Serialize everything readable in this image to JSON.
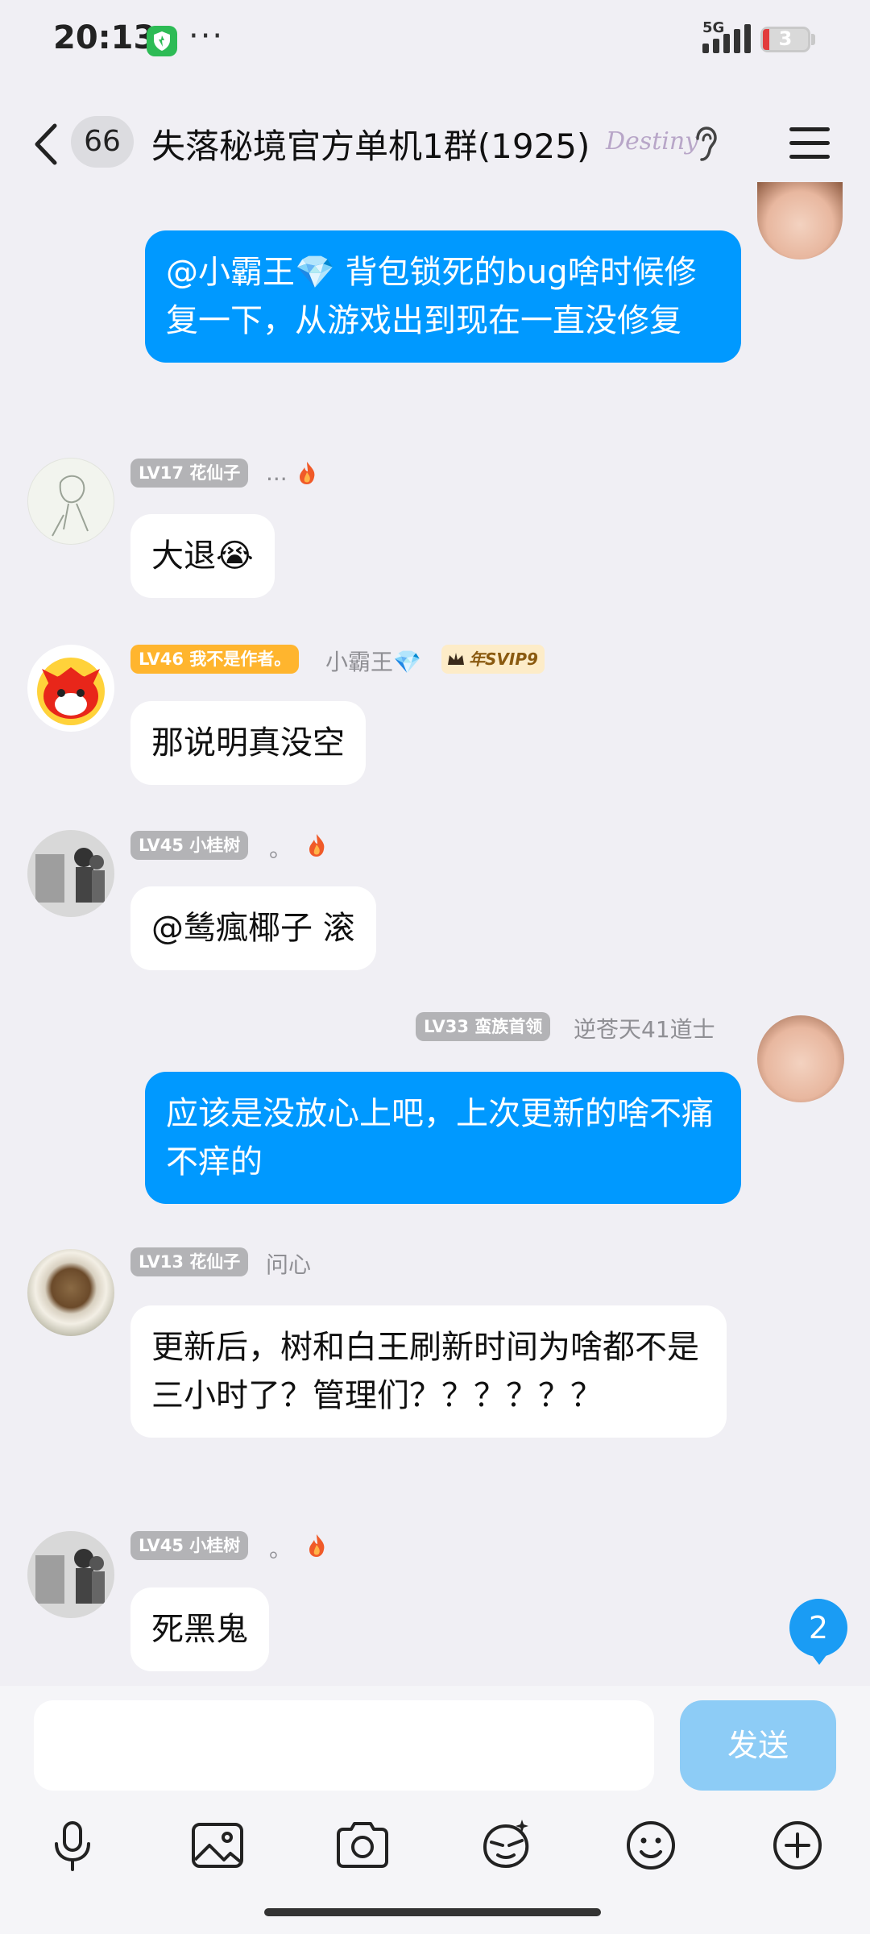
{
  "status_bar": {
    "time": "20:13",
    "more": "···",
    "network": "5G",
    "battery": "3"
  },
  "title_bar": {
    "unread_count": "66",
    "title": "失落秘境官方单机1群(1925)",
    "logo_text": "Destiny"
  },
  "messages": [
    {
      "side": "right",
      "text": "@小霸王💎 背包锁死的bug啥时候修复一下，从游戏出到现在一直没修复"
    },
    {
      "side": "left",
      "level": "LV17 花仙子",
      "name": "...",
      "text": "大退😭"
    },
    {
      "side": "left",
      "level": "LV46 我不是作者。",
      "name": "小霸王💎",
      "vip": "年SVIP9",
      "text": "那说明真没空"
    },
    {
      "side": "left",
      "level": "LV45 小桂树",
      "name": "。",
      "text": "@鸶瘋椰子 滚"
    },
    {
      "side": "right",
      "level": "LV33 蛮族首领",
      "name": "逆苍天41道士",
      "text": "应该是没放心上吧，上次更新的啥不痛不痒的"
    },
    {
      "side": "left",
      "level": "LV13 花仙子",
      "name": "问心",
      "text": "更新后，树和白王刷新时间为啥都不是三小时了？管理们？？？？？？"
    },
    {
      "side": "left",
      "level": "LV45 小桂树",
      "name": "。",
      "text": "死黑鬼"
    }
  ],
  "new_message_count": "2",
  "input_bar": {
    "placeholder": "",
    "send_label": "发送"
  },
  "icons": [
    "back-icon",
    "ear-icon",
    "menu-icon",
    "mic-icon",
    "image-icon",
    "camera-icon",
    "sticker-icon",
    "emoji-icon",
    "plus-icon"
  ]
}
